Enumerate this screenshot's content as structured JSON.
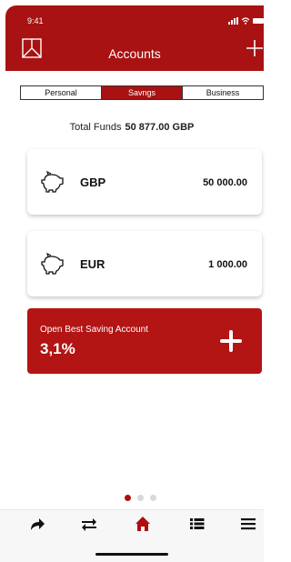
{
  "status": {
    "time": "9:41"
  },
  "header": {
    "title": "Accounts"
  },
  "tabs": [
    {
      "label": "Personal",
      "active": false
    },
    {
      "label": "Savngs",
      "active": true
    },
    {
      "label": "Business",
      "active": false
    }
  ],
  "total": {
    "label": "Total Funds",
    "value": "50 877.00 GBP"
  },
  "accounts": [
    {
      "currency": "GBP",
      "amount": "50 000.00",
      "icon": "piggy-bank-icon"
    },
    {
      "currency": "EUR",
      "amount": "1 000.00",
      "icon": "piggy-bank-icon"
    }
  ],
  "promo": {
    "label": "Open Best Saving Account",
    "rate": "3,1%"
  },
  "pager": {
    "count": 3,
    "active": 0
  },
  "nav": [
    "share-icon",
    "transfer-icon",
    "home-icon",
    "list-icon",
    "menu-icon"
  ],
  "colors": {
    "brand": "#a81212",
    "promo": "#b31414"
  }
}
